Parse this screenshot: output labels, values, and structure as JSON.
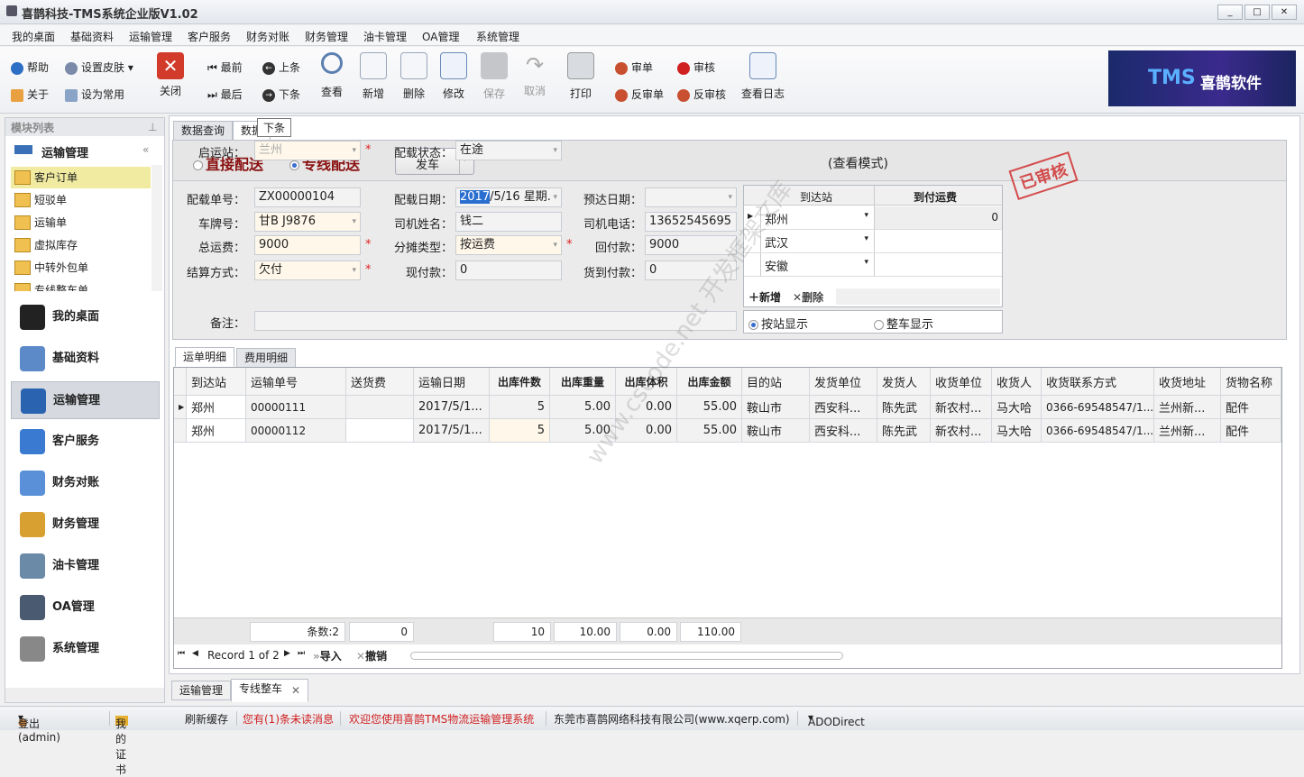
{
  "window": {
    "title": "喜鹊科技-TMS系统企业版V1.02",
    "controls": [
      "_",
      "□",
      "✕"
    ]
  },
  "menu": [
    "我的桌面",
    "基础资料",
    "运输管理",
    "客户服务",
    "财务对账",
    "财务管理",
    "油卡管理",
    "OA管理",
    "系统管理"
  ],
  "toolbar": {
    "help": "帮助",
    "skin": "设置皮肤",
    "about": "关于",
    "set_common": "设为常用",
    "close": "关闭",
    "first": "最前",
    "last": "最后",
    "prev": "上条",
    "next": "下条",
    "view": "查看",
    "add": "新增",
    "delete": "删除",
    "edit": "修改",
    "save": "保存",
    "cancel": "取消",
    "print": "打印",
    "audit_order": "审单",
    "audit": "审核",
    "unaudit_order": "反审单",
    "unaudit": "反审核",
    "view_log": "查看日志",
    "tooltip": "下条"
  },
  "logo": {
    "text": "TMS",
    "brand": "喜鹊软件"
  },
  "sidebar": {
    "title": "模块列表",
    "group": "运输管理",
    "items": [
      "客户订单",
      "短驳单",
      "运输单",
      "虚拟库存",
      "中转外包单",
      "专线整车单"
    ],
    "nav": [
      "我的桌面",
      "基础资料",
      "运输管理",
      "客户服务",
      "财务对账",
      "财务管理",
      "油卡管理",
      "OA管理",
      "系统管理"
    ]
  },
  "tabs": {
    "query": "数据查询",
    "detail": "数据"
  },
  "form": {
    "mode_direct": "直接配送",
    "mode_line": "专线配送",
    "dispatch_button": "发车",
    "view_mode": "(查看模式)",
    "stamp": "已审核",
    "fields": {
      "start_label": "启运站：",
      "start": "兰州",
      "status_label": "配载状态：",
      "status": "在途",
      "no_label": "配载单号：",
      "no": "ZX00000104",
      "date_label": "配载日期：",
      "date_sel": "2017",
      "date_rest": "/5/16 星期.",
      "eta_label": "预达日期：",
      "eta": "",
      "plate_label": "车牌号：",
      "plate": "甘B J9876",
      "driver_label": "司机姓名：",
      "driver": "钱二",
      "phone_label": "司机电话：",
      "phone": "13652545695",
      "fee_label": "总运费：",
      "fee": "9000",
      "split_label": "分摊类型：",
      "split": "按运费",
      "back_label": "回付款：",
      "back": "9000",
      "settle_label": "结算方式：",
      "settle": "欠付",
      "cash_label": "现付款：",
      "cash": "0",
      "cod_label": "货到付款：",
      "cod": "0",
      "remark_label": "备注：",
      "remark": ""
    },
    "station_grid": {
      "headers": [
        "到达站",
        "到付运费"
      ],
      "rows": [
        [
          "郑州",
          "0"
        ],
        [
          "武汉",
          ""
        ],
        [
          "安徽",
          ""
        ]
      ],
      "add": "新增",
      "delete": "删除"
    },
    "display_station": "按站显示",
    "display_vehicle": "整车显示"
  },
  "detail_tabs": [
    "运单明细",
    "费用明细"
  ],
  "grid": {
    "headers": [
      "到达站",
      "运输单号",
      "送货费",
      "运输日期",
      "出库件数",
      "出库重量",
      "出库体积",
      "出库金额",
      "目的站",
      "发货单位",
      "发货人",
      "收货单位",
      "收货人",
      "收货联系方式",
      "收货地址",
      "货物名称"
    ],
    "rows": [
      [
        "郑州",
        "00000111",
        "",
        "2017/5/1...",
        "5",
        "5.00",
        "0.00",
        "55.00",
        "鞍山市",
        "西安科...",
        "陈先武",
        "新农村...",
        "马大哈",
        "0366-69548547/1...",
        "兰州新...",
        "配件"
      ],
      [
        "郑州",
        "00000112",
        "",
        "2017/5/1...",
        "5",
        "5.00",
        "0.00",
        "55.00",
        "鞍山市",
        "西安科...",
        "陈先武",
        "新农村...",
        "马大哈",
        "0366-69548547/1...",
        "兰州新...",
        "配件"
      ]
    ],
    "summary": {
      "count": "条数:2",
      "delivery": "0",
      "qty": "10",
      "weight": "10.00",
      "volume": "0.00",
      "amount": "110.00"
    },
    "nav": {
      "record": "Record 1 of 2",
      "import": "导入",
      "revoke": "撤销"
    }
  },
  "bottom_tabs": [
    "运输管理",
    "专线整车"
  ],
  "status": {
    "logout": "登出(admin)",
    "cert": "我的证书",
    "refresh": "刷新缓存",
    "unread": "您有(1)条未读消息",
    "welcome": "欢迎您使用喜鹊TMS物流运输管理系统",
    "company": "东莞市喜鹊网络科技有限公司(www.xqerp.com)",
    "db": "ADODirect"
  },
  "watermark": "www.cscode.net 开发框架文库"
}
